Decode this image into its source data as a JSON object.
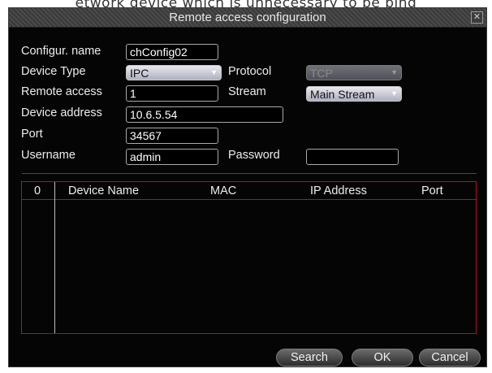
{
  "page": {
    "caption": "etwork device which is unnecessary to be bind"
  },
  "dialog": {
    "title": "Remote access configuration",
    "close_label": "✕"
  },
  "form": {
    "config_name": {
      "label": "Configur. name",
      "value": "chConfig02"
    },
    "device_type": {
      "label": "Device Type",
      "value": "IPC"
    },
    "protocol": {
      "label": "Protocol",
      "value": "TCP"
    },
    "remote_access": {
      "label": "Remote access",
      "value": "1"
    },
    "stream": {
      "label": "Stream",
      "value": "Main Stream"
    },
    "device_address": {
      "label": "Device address",
      "value": "10.6.5.54"
    },
    "port": {
      "label": "Port",
      "value": "34567"
    },
    "username": {
      "label": "Username",
      "value": "admin"
    },
    "password": {
      "label": "Password",
      "value": ""
    }
  },
  "table": {
    "columns": [
      "0",
      "Device Name",
      "MAC",
      "IP Address",
      "Port"
    ],
    "rows": []
  },
  "buttons": {
    "search": "Search",
    "ok": "OK",
    "cancel": "Cancel"
  },
  "colors": {
    "dialog_bg": "#050505",
    "table_border": "#b31218"
  }
}
